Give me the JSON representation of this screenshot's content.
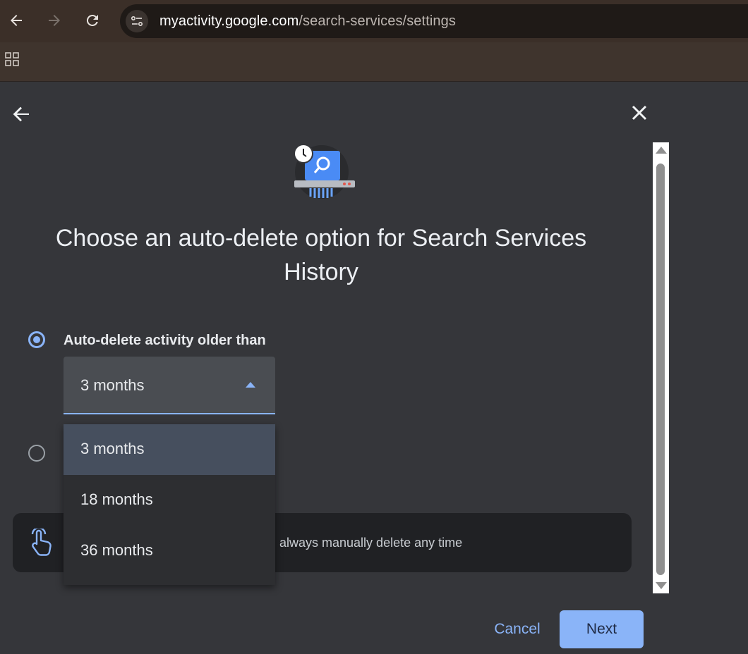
{
  "browser": {
    "url_host": "myactivity.google.com",
    "url_path": "/search-services/settings",
    "icons": [
      "back-icon",
      "forward-icon",
      "reload-icon",
      "site-info-icon",
      "apps-icon"
    ]
  },
  "dialog": {
    "title": "Choose an auto-delete option for Search Services History",
    "option_auto_delete_label": "Auto-delete activity older than",
    "selected_value": "3 months",
    "dropdown_options": [
      "3 months",
      "18 months",
      "36 months"
    ],
    "info_text_visible": "always manually delete any time",
    "cancel_label": "Cancel",
    "next_label": "Next",
    "colors": {
      "accent": "#8ab4f8",
      "background": "#35363a",
      "dropdown_selected": "#464f5e"
    }
  }
}
